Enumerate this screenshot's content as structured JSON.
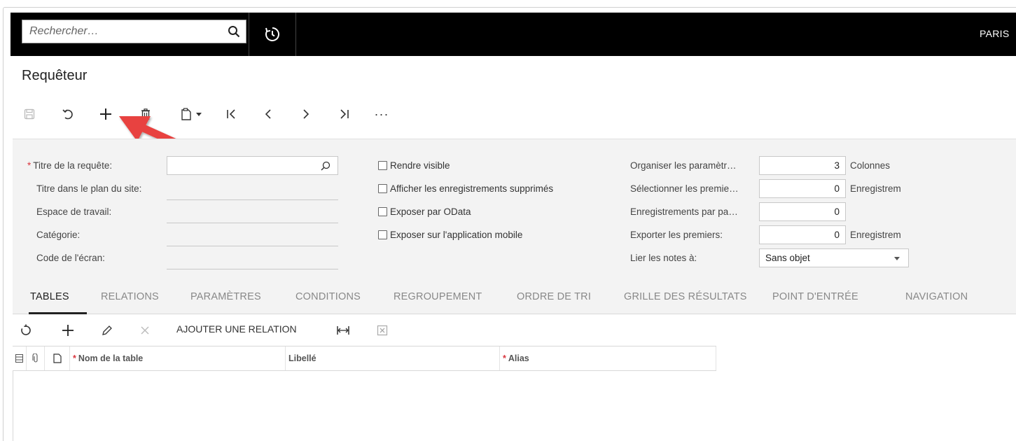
{
  "topbar": {
    "search_placeholder": "Rechercher…",
    "company": "PARIS"
  },
  "page": {
    "title": "Requêteur"
  },
  "toolbar": {
    "more": "···"
  },
  "form": {
    "left": [
      {
        "label": "Titre de la requête:",
        "required": true
      },
      {
        "label": "Titre dans le plan du site:"
      },
      {
        "label": "Espace de travail:"
      },
      {
        "label": "Catégorie:"
      },
      {
        "label": "Code de l'écran:"
      }
    ],
    "checkboxes": [
      {
        "label": "Rendre visible",
        "checked": false
      },
      {
        "label": "Afficher les enregistrements supprimés",
        "checked": false
      },
      {
        "label": "Exposer par OData",
        "checked": false
      },
      {
        "label": "Exposer sur l'application mobile",
        "checked": false
      }
    ],
    "right": [
      {
        "label": "Organiser les paramètr…",
        "value": "3",
        "suffix": "Colonnes"
      },
      {
        "label": "Sélectionner les premie…",
        "value": "0",
        "suffix": "Enregistrem"
      },
      {
        "label": "Enregistrements par pa…",
        "value": "0",
        "suffix": ""
      },
      {
        "label": "Exporter les premiers:",
        "value": "0",
        "suffix": "Enregistrem"
      },
      {
        "label": "Lier les notes à:",
        "select": "Sans objet"
      }
    ]
  },
  "tabs": [
    {
      "label": "TABLES",
      "active": true
    },
    {
      "label": "RELATIONS"
    },
    {
      "label": "PARAMÈTRES"
    },
    {
      "label": "CONDITIONS"
    },
    {
      "label": "REGROUPEMENT"
    },
    {
      "label": "ORDRE DE TRI"
    },
    {
      "label": "GRILLE DES RÉSULTATS"
    },
    {
      "label": "POINT D'ENTRÉE"
    },
    {
      "label": "NAVIGATION"
    }
  ],
  "grid_toolbar": {
    "add_relation": "AJOUTER UNE RELATION"
  },
  "grid": {
    "columns": [
      {
        "label": "Nom de la table",
        "required": true
      },
      {
        "label": "Libellé",
        "required": false
      },
      {
        "label": "Alias",
        "required": true
      }
    ],
    "required_mark": "*"
  },
  "colors": {
    "topbar": "#000000",
    "panel": "#f3f3f3",
    "required": "#d9363e",
    "arrow": "#e8433f"
  }
}
